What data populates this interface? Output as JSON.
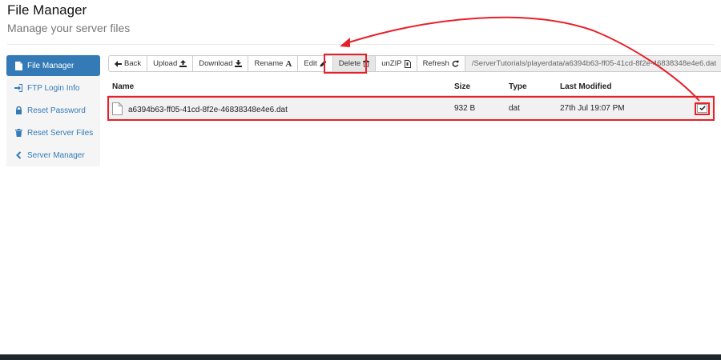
{
  "header": {
    "title": "File Manager",
    "subtitle": "Manage your server files"
  },
  "sidebar": {
    "items": [
      {
        "label": "File Manager",
        "icon": "file-icon",
        "active": true
      },
      {
        "label": "FTP Login Info",
        "icon": "sign-in-icon",
        "active": false
      },
      {
        "label": "Reset Password",
        "icon": "lock-icon",
        "active": false
      },
      {
        "label": "Reset Server Files",
        "icon": "trash-icon",
        "active": false
      },
      {
        "label": "Server Manager",
        "icon": "chevron-left-icon",
        "active": false
      }
    ]
  },
  "toolbar": {
    "back": "Back",
    "upload": "Upload",
    "download": "Download",
    "rename": "Rename",
    "edit": "Edit",
    "delete": "Delete",
    "unzip": "unZIP",
    "refresh": "Refresh",
    "path": "/ServerTutorials/playerdata/a6394b63-ff05-41cd-8f2e-46838348e4e6.dat"
  },
  "table": {
    "columns": [
      "Name",
      "Size",
      "Type",
      "Last Modified"
    ],
    "rows": [
      {
        "name": "a6394b63-ff05-41cd-8f2e-46838348e4e6.dat",
        "size": "932 B",
        "type": "dat",
        "modified": "27th Jul 19:07 PM",
        "selected": true
      }
    ]
  },
  "colors": {
    "accent": "#337ab7",
    "annotation": "#e8202a",
    "footer": "#1c262b"
  }
}
